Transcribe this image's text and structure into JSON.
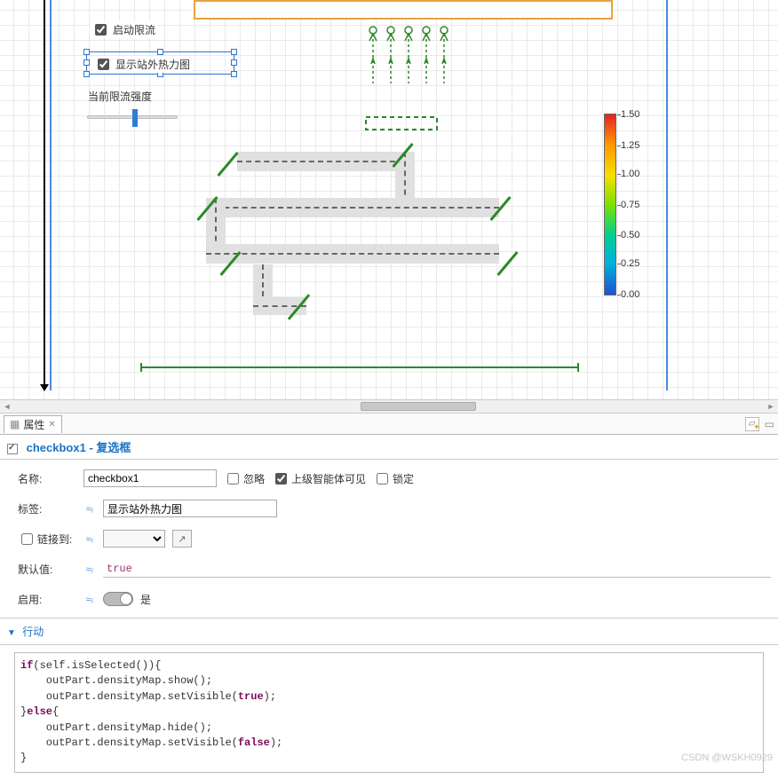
{
  "canvas": {
    "checkbox1_label": "启动限流",
    "checkbox2_label": "显示站外热力图",
    "slider_label": "当前限流强度"
  },
  "colorbar": {
    "ticks": [
      "1.50",
      "1.25",
      "1.00",
      "0.75",
      "0.50",
      "0.25",
      "0.00"
    ]
  },
  "tabs": {
    "properties": "属性"
  },
  "header": {
    "title": "checkbox1 - 复选框"
  },
  "fields": {
    "name_label": "名称:",
    "name_value": "checkbox1",
    "ignore_label": "忽略",
    "parent_visible_label": "上级智能体可见",
    "lock_label": "锁定",
    "tag_label": "标签:",
    "tag_value": "显示站外热力图",
    "linkto_label": "链接到:",
    "default_label": "默认值:",
    "default_value": "true",
    "enable_label": "启用:",
    "enable_value": "是"
  },
  "section": {
    "action": "行动"
  },
  "code": {
    "l1a": "if",
    "l1b": "(self.isSelected()){",
    "l2": "    outPart.densityMap.show();",
    "l3a": "    outPart.densityMap.setVisible(",
    "l3b": "true",
    "l3c": ");",
    "l4a": "}",
    "l4b": "else",
    "l4c": "{",
    "l5": "    outPart.densityMap.hide();",
    "l6a": "    outPart.densityMap.setVisible(",
    "l6b": "false",
    "l6c": ");",
    "l7": "}"
  },
  "watermark": "CSDN @WSKH0929"
}
